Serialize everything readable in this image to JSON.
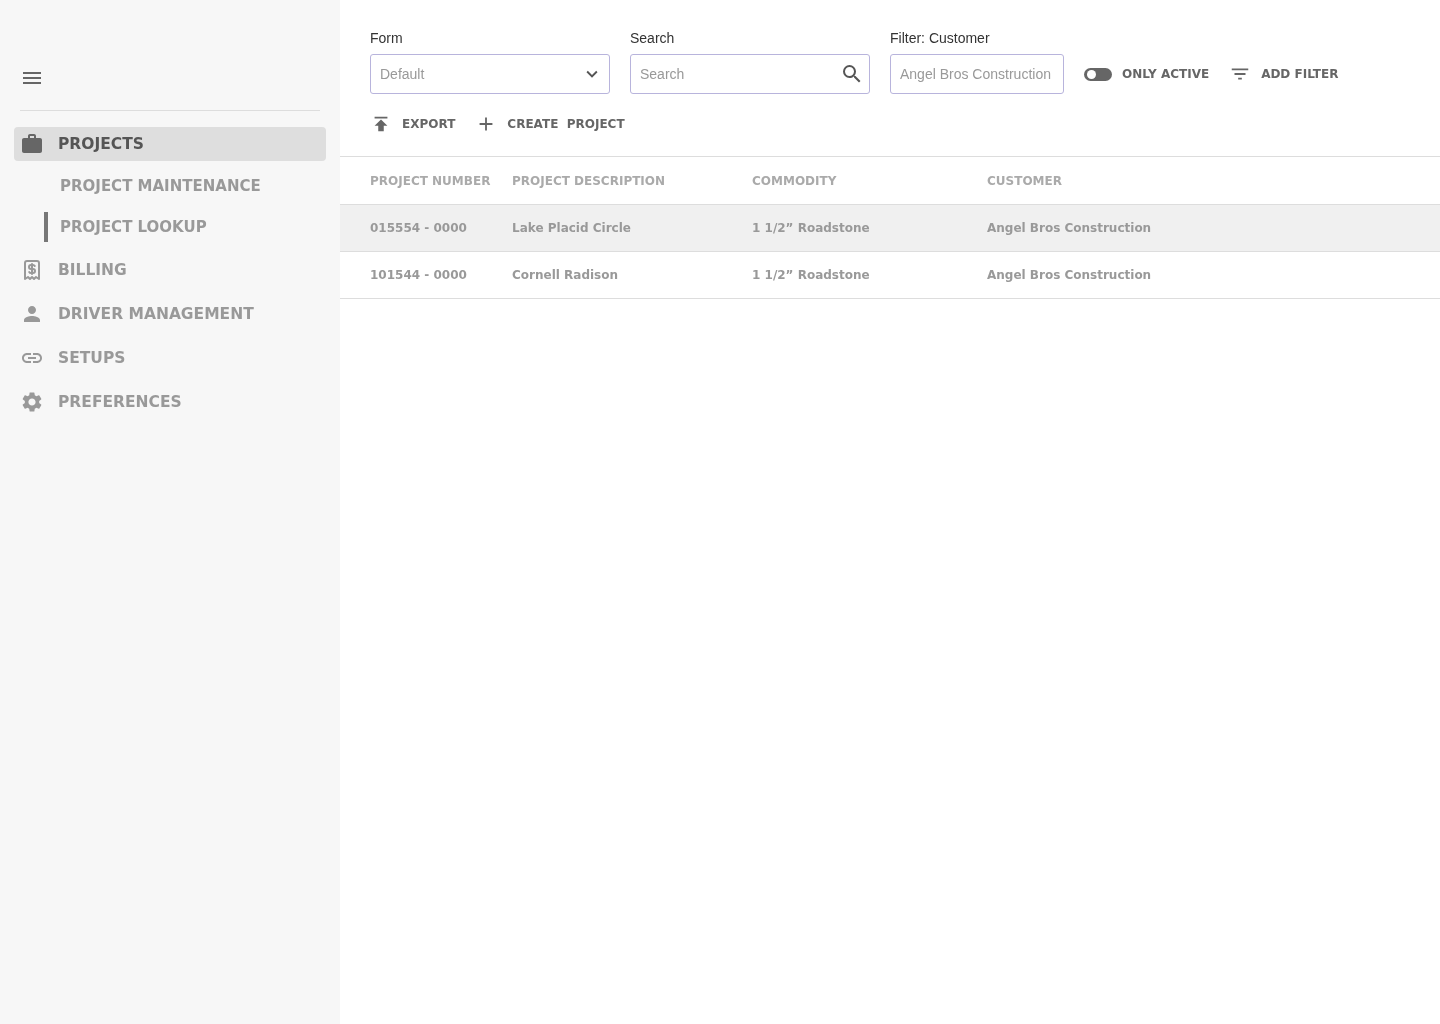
{
  "sidebar": {
    "items": [
      {
        "label": "PROJECTS",
        "selected": true,
        "children": [
          {
            "label": "PROJECT MAINTENANCE",
            "selected": false
          },
          {
            "label": "PROJECT LOOKUP",
            "selected": true
          }
        ]
      },
      {
        "label": "BILLING",
        "selected": false
      },
      {
        "label": "DRIVER MANAGEMENT",
        "selected": false
      },
      {
        "label": "SETUPS",
        "selected": false
      },
      {
        "label": "PREFERENCES",
        "selected": false
      }
    ]
  },
  "toolbar": {
    "form": {
      "label": "Form",
      "value": "Default"
    },
    "search": {
      "label": "Search",
      "placeholder": "Search"
    },
    "customer_filter": {
      "label": "Filter: Customer",
      "placeholder": "Angel Bros Construction"
    },
    "only_active": {
      "label": "ONLY ACTIVE",
      "on": false
    },
    "add_filter": "ADD FILTER",
    "export": "EXPORT",
    "create_project": "CREATE  PROJECT"
  },
  "table": {
    "columns": [
      "PROJECT NUMBER",
      "PROJECT DESCRIPTION",
      "COMMODITY",
      "CUSTOMER"
    ],
    "rows": [
      {
        "cells": [
          "015554 - 0000",
          "Lake Placid Circle",
          "1 1/2” Roadstone",
          "Angel Bros Construction"
        ],
        "selected": true
      },
      {
        "cells": [
          "101544 - 0000",
          "Cornell Radison",
          "1 1/2” Roadstone",
          "Angel Bros Construction"
        ],
        "selected": false
      }
    ]
  }
}
